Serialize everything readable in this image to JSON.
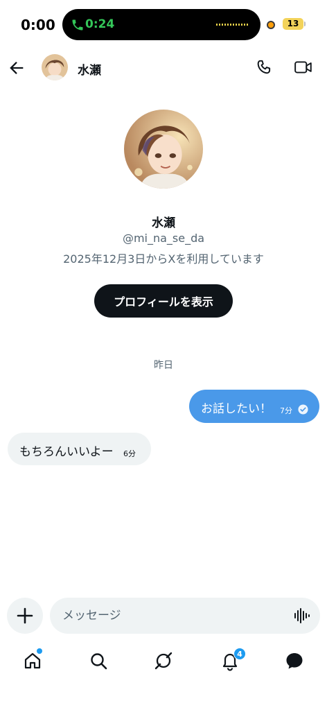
{
  "status_bar": {
    "time": "0:00",
    "call_timer": "0:24",
    "battery": "13"
  },
  "header": {
    "name": "水瀬",
    "icons": [
      "back-arrow-icon",
      "phone-icon",
      "video-camera-icon"
    ]
  },
  "profile": {
    "name": "水瀬",
    "handle": "@mi_na_se_da",
    "joined": "2025年12月3日からXを利用しています",
    "button_label": "プロフィールを表示"
  },
  "messages": {
    "date_separator": "昨日",
    "items": [
      {
        "direction": "sent",
        "text": "お話したい！",
        "time": "7分",
        "read": true
      },
      {
        "direction": "received",
        "text": "もちろんいいよー",
        "time": "6分"
      }
    ]
  },
  "composer": {
    "placeholder": "メッセージ",
    "value": ""
  },
  "tabbar": {
    "items": [
      "home-icon",
      "search-icon",
      "grok-icon",
      "notifications-icon",
      "messages-icon"
    ],
    "notification_count": "4"
  },
  "colors": {
    "accent": "#1d9bf0",
    "sent_bubble": "#4a99e9",
    "received_bubble": "#eff3f4",
    "call_green": "#34c759"
  }
}
